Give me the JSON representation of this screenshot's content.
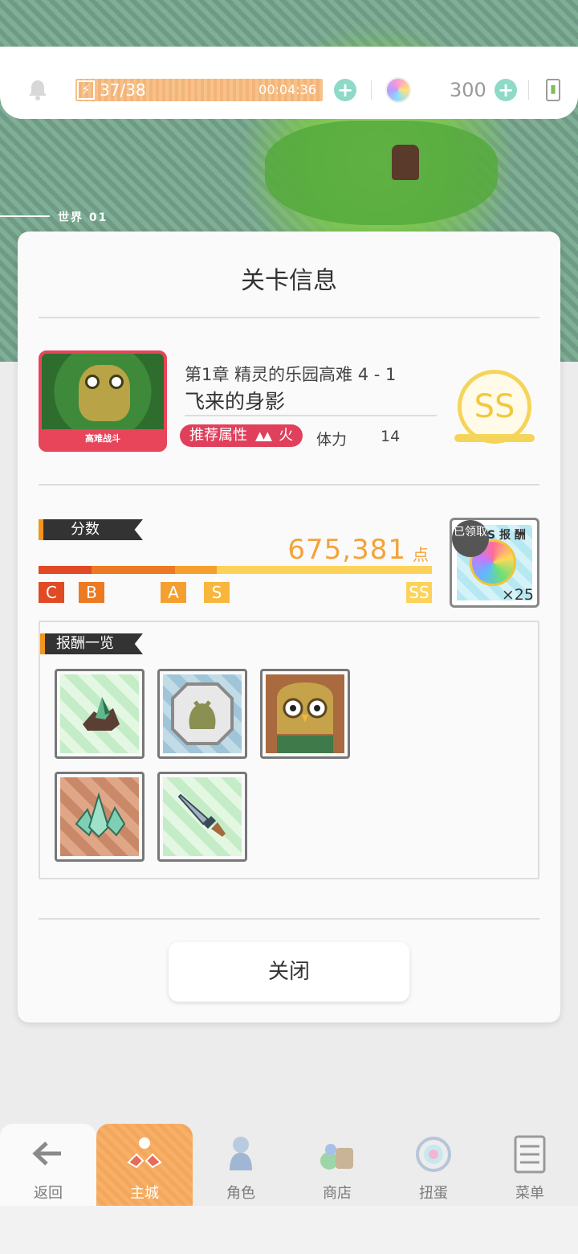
{
  "status_bar": {
    "stamina": "37/38",
    "stamina_timer": "00:04:36",
    "gems": "300"
  },
  "map": {
    "world_label": "世界 01"
  },
  "dialog": {
    "title": "关卡信息",
    "stage": {
      "thumb_band": "高难战斗",
      "chapter": "第1章 精灵的乐园高难 4 - 1",
      "name": "飞来的身影",
      "recommended_attr_label": "推荐属性",
      "attribute": "火",
      "stamina_label": "体力",
      "stamina_cost": "14",
      "rank": "SS"
    },
    "score": {
      "section_label": "分数",
      "value": "675,381",
      "unit": "点",
      "ranks": [
        "C",
        "B",
        "A",
        "S",
        "SS"
      ],
      "progress": 1.0,
      "accent_color": "#f5a23a"
    },
    "ss_reward": {
      "header": "S 报 酬",
      "claimed": "已领取",
      "count": "×25"
    },
    "rewards": {
      "section_label": "报酬一览",
      "items": [
        {
          "icon": "crystal-ore-icon"
        },
        {
          "icon": "slime-coin-icon"
        },
        {
          "icon": "owl-character-icon"
        },
        {
          "icon": "crystal-cluster-icon"
        },
        {
          "icon": "sword-icon"
        }
      ]
    },
    "close_label": "关闭"
  },
  "nav": {
    "items": [
      {
        "label": "返回",
        "icon": "back-arrow-icon"
      },
      {
        "label": "主城",
        "icon": "main-city-icon"
      },
      {
        "label": "角色",
        "icon": "character-icon"
      },
      {
        "label": "商店",
        "icon": "shop-icon"
      },
      {
        "label": "扭蛋",
        "icon": "gacha-icon"
      },
      {
        "label": "菜单",
        "icon": "menu-icon"
      }
    ],
    "active_index": 1
  }
}
